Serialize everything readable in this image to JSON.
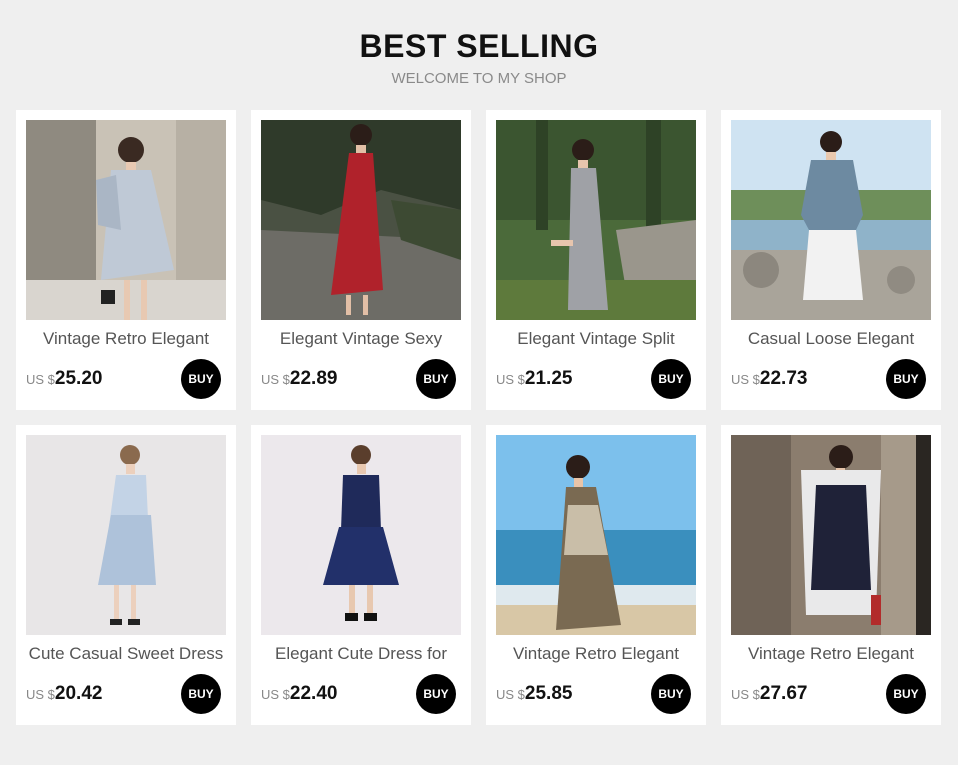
{
  "header": {
    "title": "BEST SELLING",
    "subtitle": "WELCOME TO MY SHOP"
  },
  "products": [
    {
      "name": "Vintage Retro Elegant",
      "currency": "US $",
      "price": "25.20",
      "buy_label": "BUY"
    },
    {
      "name": "Elegant Vintage Sexy",
      "currency": "US $",
      "price": "22.89",
      "buy_label": "BUY"
    },
    {
      "name": "Elegant Vintage Split",
      "currency": "US $",
      "price": "21.25",
      "buy_label": "BUY"
    },
    {
      "name": "Casual Loose Elegant",
      "currency": "US $",
      "price": "22.73",
      "buy_label": "BUY"
    },
    {
      "name": "Cute Casual Sweet Dress",
      "currency": "US $",
      "price": "20.42",
      "buy_label": "BUY"
    },
    {
      "name": "Elegant Cute Dress for",
      "currency": "US $",
      "price": "22.40",
      "buy_label": "BUY"
    },
    {
      "name": "Vintage Retro Elegant",
      "currency": "US $",
      "price": "25.85",
      "buy_label": "BUY"
    },
    {
      "name": "Vintage Retro Elegant",
      "currency": "US $",
      "price": "27.67",
      "buy_label": "BUY"
    }
  ]
}
